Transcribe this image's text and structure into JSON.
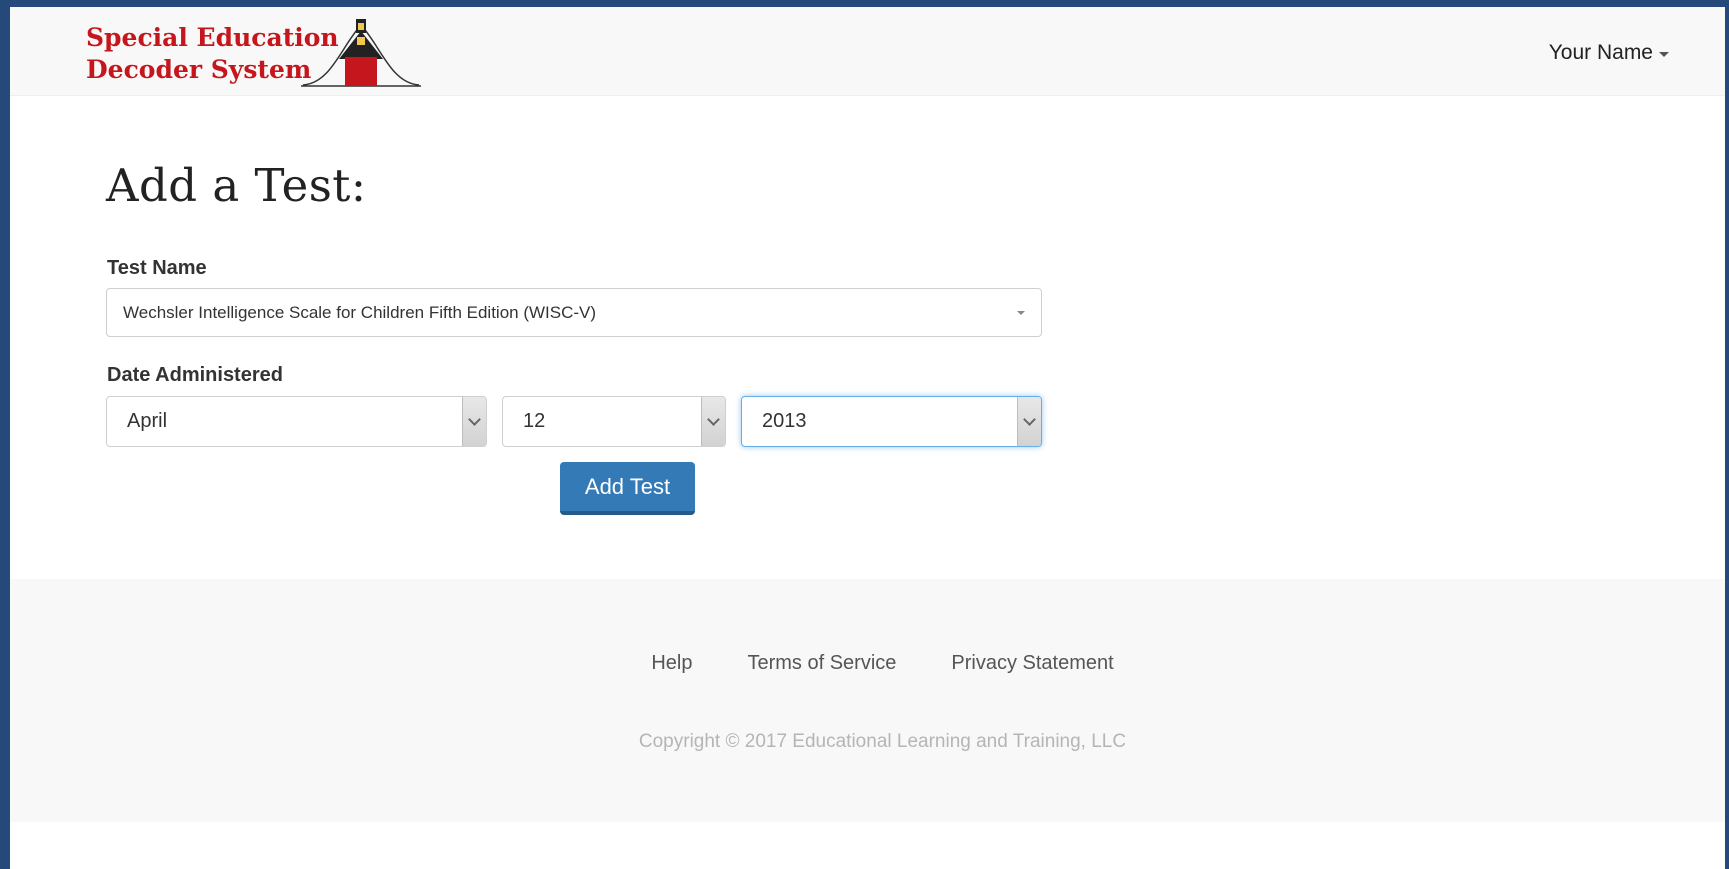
{
  "header": {
    "brand_line1": "Special Education",
    "brand_line2": "Decoder System",
    "user_name": "Your Name"
  },
  "main": {
    "title": "Add a Test:",
    "test_name_label": "Test Name",
    "test_name_value": "Wechsler Intelligence Scale for Children Fifth Edition (WISC-V)",
    "date_label": "Date Administered",
    "month_value": "April",
    "day_value": "12",
    "year_value": "2013",
    "add_button": "Add Test"
  },
  "footer": {
    "links": [
      "Help",
      "Terms of Service",
      "Privacy Statement"
    ],
    "copyright": "Copyright © 2017 Educational Learning and Training, LLC"
  },
  "colors": {
    "brand_red": "#c4161c",
    "primary_button": "#337ab7",
    "outer_frame": "#24497a"
  }
}
